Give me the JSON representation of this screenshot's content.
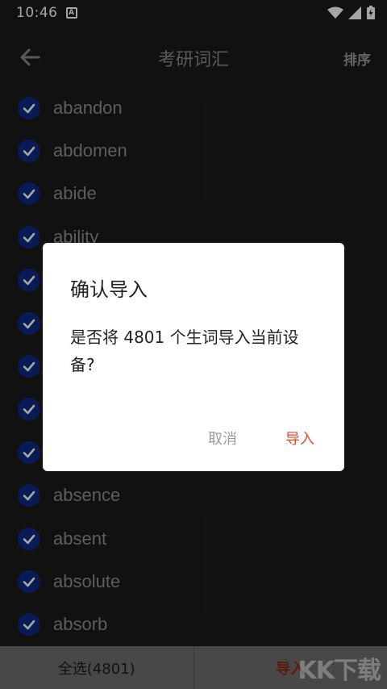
{
  "status_bar": {
    "time": "10:46",
    "notif_letter": "A"
  },
  "app_bar": {
    "title": "考研词汇",
    "sort_label": "排序"
  },
  "words": [
    "abandon",
    "abdomen",
    "abide",
    "ability",
    "",
    "",
    "",
    "",
    "",
    "absence",
    "absent",
    "absolute",
    "absorb"
  ],
  "bottom_bar": {
    "select_all_label": "全选(4801)",
    "import_label": "导入"
  },
  "dialog": {
    "title": "确认导入",
    "message": "是否将 4801 个生词导入当前设备?",
    "cancel_label": "取消",
    "confirm_label": "导入"
  },
  "watermark": "KK下载",
  "colors": {
    "accent": "#e0492e",
    "check": "#0d2a86",
    "background": "#1b1b1b"
  }
}
